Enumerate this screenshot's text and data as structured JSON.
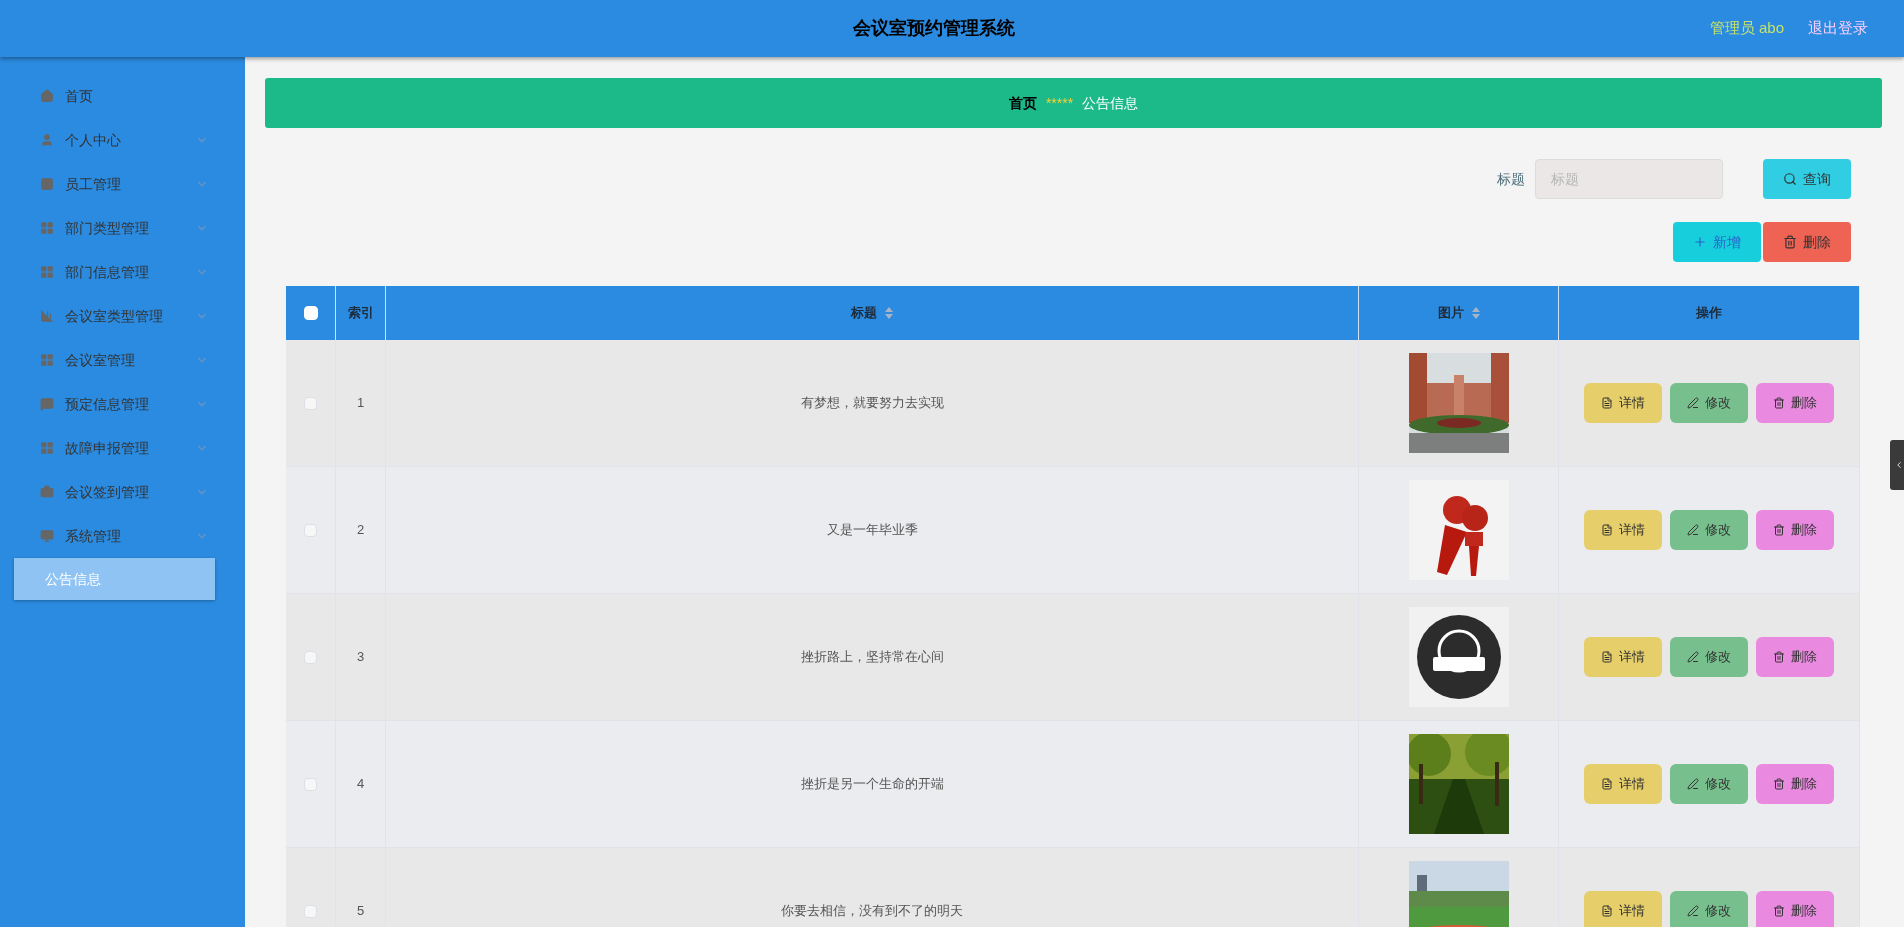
{
  "header": {
    "title": "会议室预约管理系统",
    "user": "管理员 abo",
    "logout": "退出登录"
  },
  "sidebar": {
    "items": [
      {
        "label": "首页",
        "kind": "link",
        "selected": false
      },
      {
        "label": "个人中心",
        "kind": "menu",
        "selected": false
      },
      {
        "label": "员工管理",
        "kind": "menu",
        "selected": false
      },
      {
        "label": "部门类型管理",
        "kind": "menu",
        "selected": false
      },
      {
        "label": "部门信息管理",
        "kind": "menu",
        "selected": false
      },
      {
        "label": "会议室类型管理",
        "kind": "menu",
        "selected": false
      },
      {
        "label": "会议室管理",
        "kind": "menu",
        "selected": false
      },
      {
        "label": "预定信息管理",
        "kind": "menu",
        "selected": false
      },
      {
        "label": "故障申报管理",
        "kind": "menu",
        "selected": false
      },
      {
        "label": "会议签到管理",
        "kind": "menu",
        "selected": false
      },
      {
        "label": "系统管理",
        "kind": "menu",
        "selected": false,
        "children": [
          {
            "label": "公告信息",
            "selected": true
          }
        ]
      }
    ]
  },
  "breadcrumb": {
    "home": "首页",
    "separator": "*****",
    "current": "公告信息"
  },
  "search": {
    "label": "标题",
    "placeholder": "标题",
    "button": "查询"
  },
  "actions": [
    {
      "label": "新增",
      "kind": "add"
    },
    {
      "label": "删除",
      "kind": "delete"
    }
  ],
  "table": {
    "select_all": {
      "checked": false
    },
    "columns": [
      {
        "label": "索引",
        "sortable": false
      },
      {
        "label": "标题",
        "sortable": true
      },
      {
        "label": "图片",
        "sortable": true
      },
      {
        "label": "操作",
        "sortable": false
      }
    ],
    "rows": [
      {
        "checked": false,
        "index": "1",
        "title": "有梦想，就要努力去实现",
        "image": {
          "kind": "picture"
        },
        "buttons": [
          {
            "label": "详情",
            "kind": "detail"
          },
          {
            "label": "修改",
            "kind": "edit"
          },
          {
            "label": "删除",
            "kind": "delete"
          }
        ]
      },
      {
        "checked": false,
        "index": "2",
        "title": "又是一年毕业季",
        "image": {
          "kind": "picture"
        },
        "buttons": [
          {
            "label": "详情",
            "kind": "detail"
          },
          {
            "label": "修改",
            "kind": "edit"
          },
          {
            "label": "删除",
            "kind": "delete"
          }
        ]
      },
      {
        "checked": false,
        "index": "3",
        "title": "挫折路上，坚持常在心间",
        "image": {
          "kind": "picture"
        },
        "buttons": [
          {
            "label": "详情",
            "kind": "detail"
          },
          {
            "label": "修改",
            "kind": "edit"
          },
          {
            "label": "删除",
            "kind": "delete"
          }
        ]
      },
      {
        "checked": false,
        "index": "4",
        "title": "挫折是另一个生命的开端",
        "image": {
          "kind": "picture"
        },
        "buttons": [
          {
            "label": "详情",
            "kind": "detail"
          },
          {
            "label": "修改",
            "kind": "edit"
          },
          {
            "label": "删除",
            "kind": "delete"
          }
        ]
      },
      {
        "checked": false,
        "index": "5",
        "title": "你要去相信，没有到不了的明天",
        "image": {
          "kind": "picture"
        },
        "buttons": [
          {
            "label": "详情",
            "kind": "detail"
          },
          {
            "label": "修改",
            "kind": "edit"
          },
          {
            "label": "删除",
            "kind": "delete"
          }
        ]
      }
    ]
  }
}
